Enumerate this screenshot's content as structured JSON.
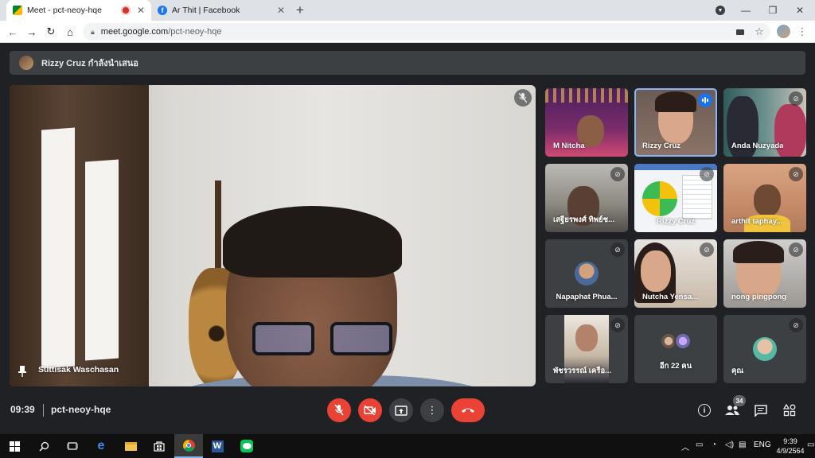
{
  "browser": {
    "tabs": [
      {
        "title": "Meet - pct-neoy-hqe",
        "favicon": "meet-icon",
        "recording": true
      },
      {
        "title": "Ar Thit | Facebook",
        "favicon": "facebook-icon",
        "recording": false
      }
    ],
    "url": {
      "host": "meet.google.com",
      "path": "/pct-neoy-hqe"
    }
  },
  "meet": {
    "presenting_banner": "Rizzy Cruz กำลังนำเสนอ",
    "main_speaker": {
      "name": "Suttisak Waschasan",
      "muted": true
    },
    "tiles": [
      {
        "name": "M Nitcha",
        "muted": false
      },
      {
        "name": "Rizzy Cruz",
        "muted": false,
        "speaking": true
      },
      {
        "name": "Anda Nuzyada",
        "muted": true
      },
      {
        "name": "เสฐียรพงศ์ ทิพย์ช...",
        "muted": true
      },
      {
        "name": "Rizzy Cruz",
        "muted": true,
        "presentation": true
      },
      {
        "name": "arthit taphay...",
        "muted": true
      },
      {
        "name": "Napaphat Phua...",
        "muted": true
      },
      {
        "name": "Nutcha Yensa...",
        "muted": true
      },
      {
        "name": "nong pingpong",
        "muted": true
      },
      {
        "name": "พัชรวรรณ์ เครือ...",
        "muted": true
      },
      {
        "name": "อีก 22 คน",
        "muted": false
      },
      {
        "name": "คุณ",
        "muted": true
      }
    ],
    "bottom": {
      "time": "09:39",
      "code": "pct-neoy-hqe",
      "participant_count": "34"
    }
  },
  "taskbar": {
    "language": "ENG",
    "time": "9:39",
    "date": "4/9/2564"
  },
  "colors": {
    "meet_bg": "#202124",
    "danger_red": "#ea4335",
    "speaking_blue": "#1a73e8"
  }
}
